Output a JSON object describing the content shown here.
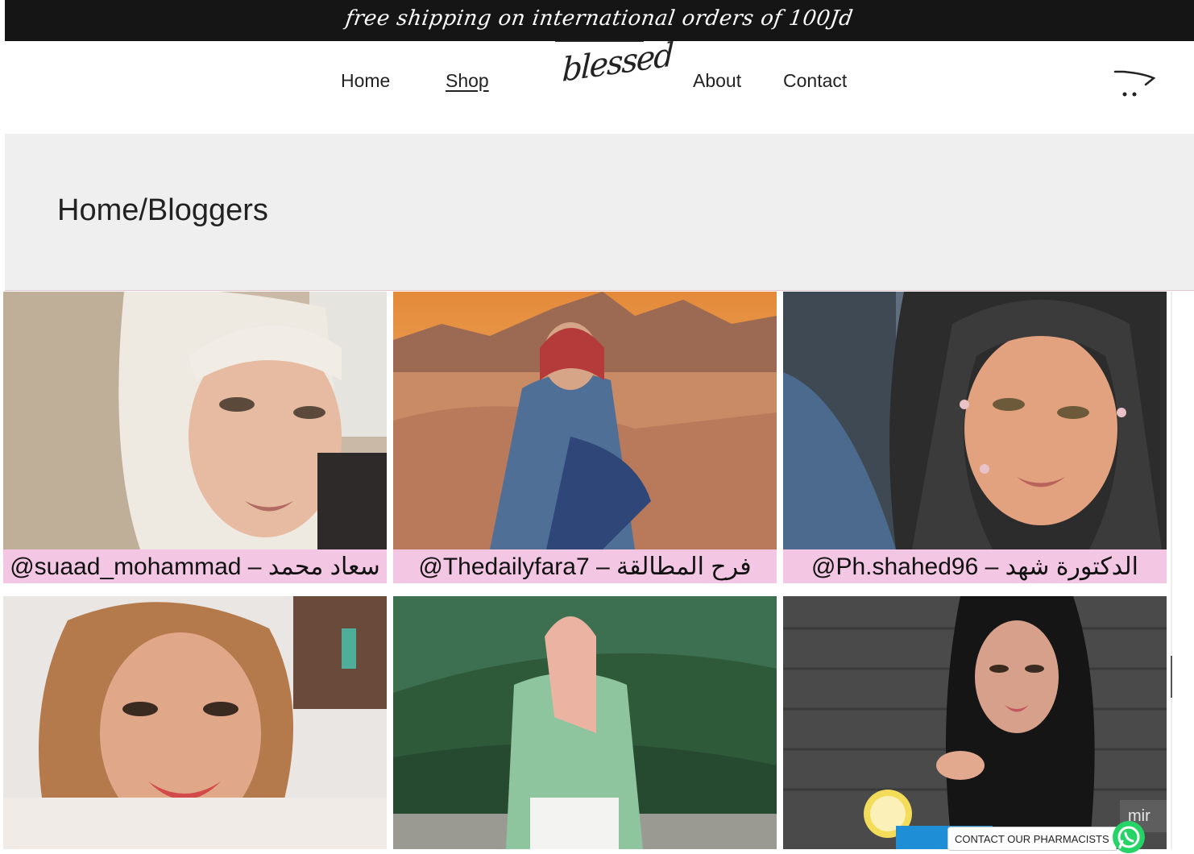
{
  "announcement": "free shipping on international orders of 100Jd",
  "nav": {
    "home": "Home",
    "shop": "Shop",
    "about": "About",
    "contact": "Contact"
  },
  "logo": "blessed",
  "icons": {
    "cart": "cart-icon",
    "whatsapp": "whatsapp-icon"
  },
  "breadcrumb": "Home/Bloggers",
  "bloggers": [
    {
      "caption": "@suaad_mohammad – سعاد محمد"
    },
    {
      "caption": "@Thedailyfara7 – فرح المطالقة"
    },
    {
      "caption": "@Ph.shahed96 – الدكتورة شهد"
    },
    {
      "caption": ""
    },
    {
      "caption": ""
    },
    {
      "caption": ""
    }
  ],
  "contact_pharmacists": "CONTACT OUR PHARMACISTS",
  "badge": "mir",
  "colors": {
    "caption_bg": "#f3c6e3",
    "banner_bg": "#151515",
    "band_bg": "#efefef",
    "whatsapp": "#25d366"
  }
}
